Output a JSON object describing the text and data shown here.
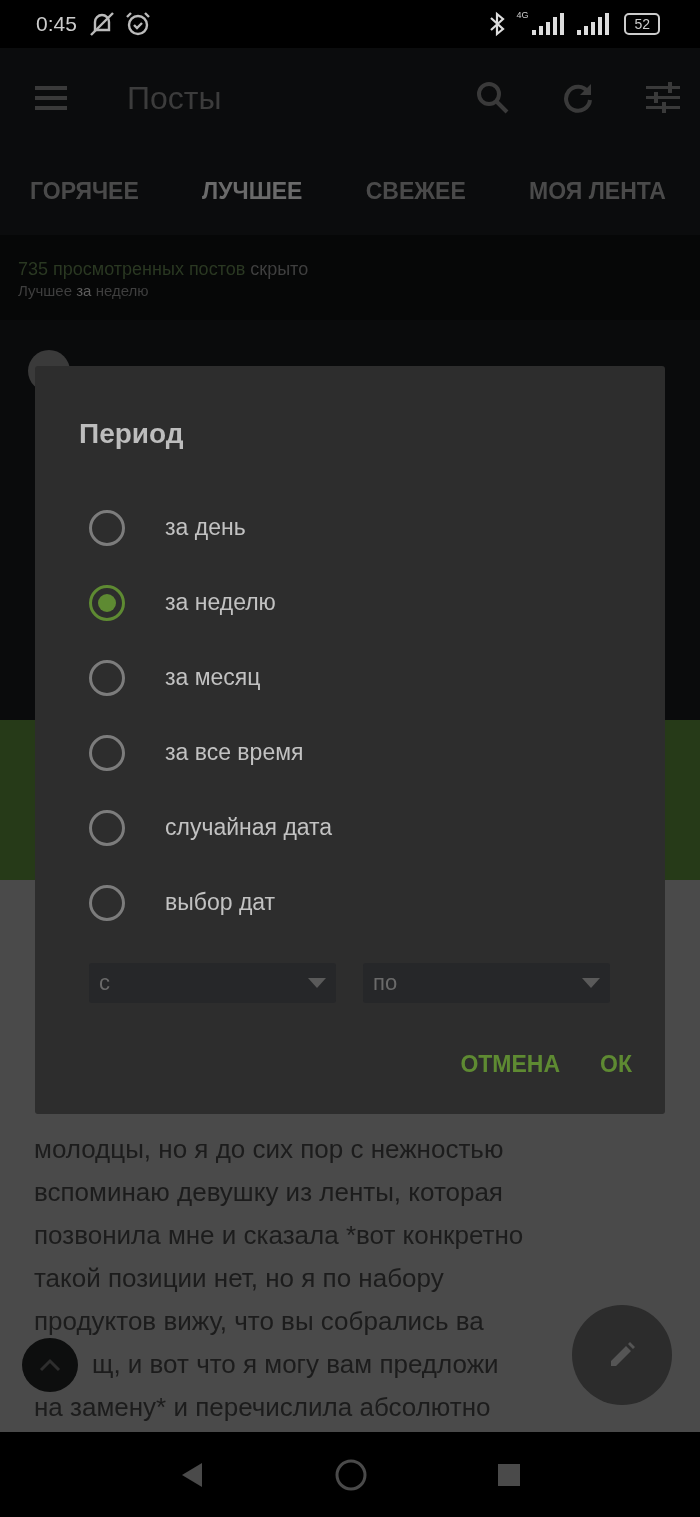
{
  "status_bar": {
    "time": "0:45",
    "network": "4G",
    "battery": "52"
  },
  "app_bar": {
    "title": "Посты"
  },
  "tabs": [
    {
      "label": "ГОРЯЧЕЕ",
      "selected": false
    },
    {
      "label": "ЛУЧШЕЕ",
      "selected": true
    },
    {
      "label": "СВЕЖЕЕ",
      "selected": false
    },
    {
      "label": "МОЯ ЛЕНТА",
      "selected": false
    }
  ],
  "info": {
    "hidden_count": "735 просмотренных постов",
    "hidden_word": "скрыто",
    "period_parts": [
      {
        "text": "Лучшее",
        "highlighted": false
      },
      {
        "text": "за",
        "highlighted": true
      },
      {
        "text": "неделю",
        "highlighted": false
      }
    ]
  },
  "post_text_lines": [
    "молодцы, но я до сих пор с нежностью",
    "вспоминаю девушку из ленты, которая",
    "позвонила мне и сказала *вот конкретно",
    "такой позиции нет, но я по набору",
    "продуктов вижу, что вы собрались ва",
    "щ, и вот что я могу вам предложи",
    "на замену* и перечислила абсолютно"
  ],
  "dialog": {
    "title": "Период",
    "options": [
      {
        "label": "за день",
        "selected": false
      },
      {
        "label": "за неделю",
        "selected": true
      },
      {
        "label": "за месяц",
        "selected": false
      },
      {
        "label": "за все время",
        "selected": false
      },
      {
        "label": "случайная дата",
        "selected": false
      },
      {
        "label": "выбор дат",
        "selected": false
      }
    ],
    "from_field": {
      "placeholder": "с"
    },
    "to_field": {
      "placeholder": "по"
    },
    "buttons": [
      "ОТМЕНА",
      "ОК"
    ]
  }
}
